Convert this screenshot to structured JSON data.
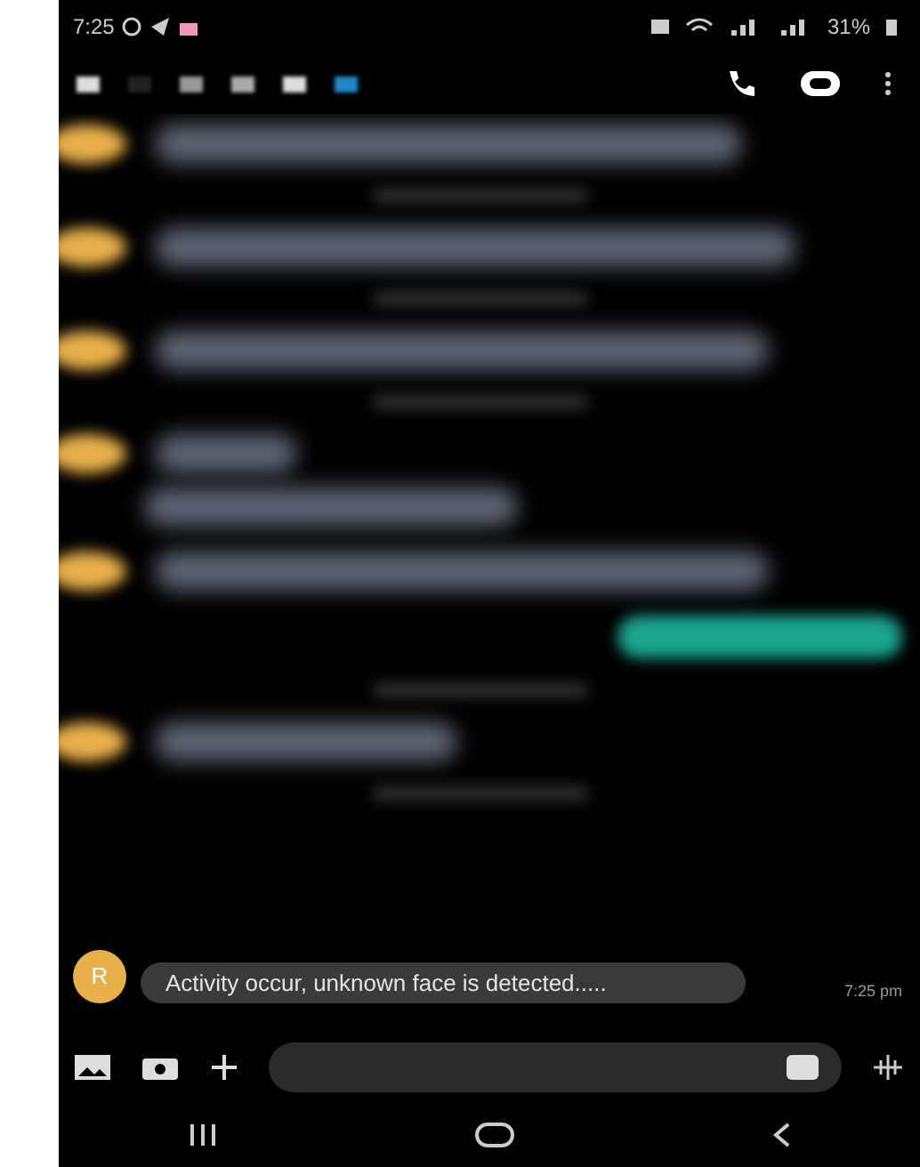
{
  "status_bar": {
    "time": "7:25",
    "battery": "31%"
  },
  "messages": [
    {
      "kind": "incoming"
    },
    {
      "kind": "divider"
    },
    {
      "kind": "incoming"
    },
    {
      "kind": "divider"
    },
    {
      "kind": "incoming"
    },
    {
      "kind": "divider"
    },
    {
      "kind": "incoming-double"
    },
    {
      "kind": "incoming"
    },
    {
      "kind": "outgoing"
    },
    {
      "kind": "divider"
    },
    {
      "kind": "incoming-short"
    },
    {
      "kind": "divider"
    },
    {
      "kind": "text",
      "sender_initial": "R",
      "text": "Activity occur, unknown face is detected.....",
      "time": "7:25 pm"
    }
  ]
}
